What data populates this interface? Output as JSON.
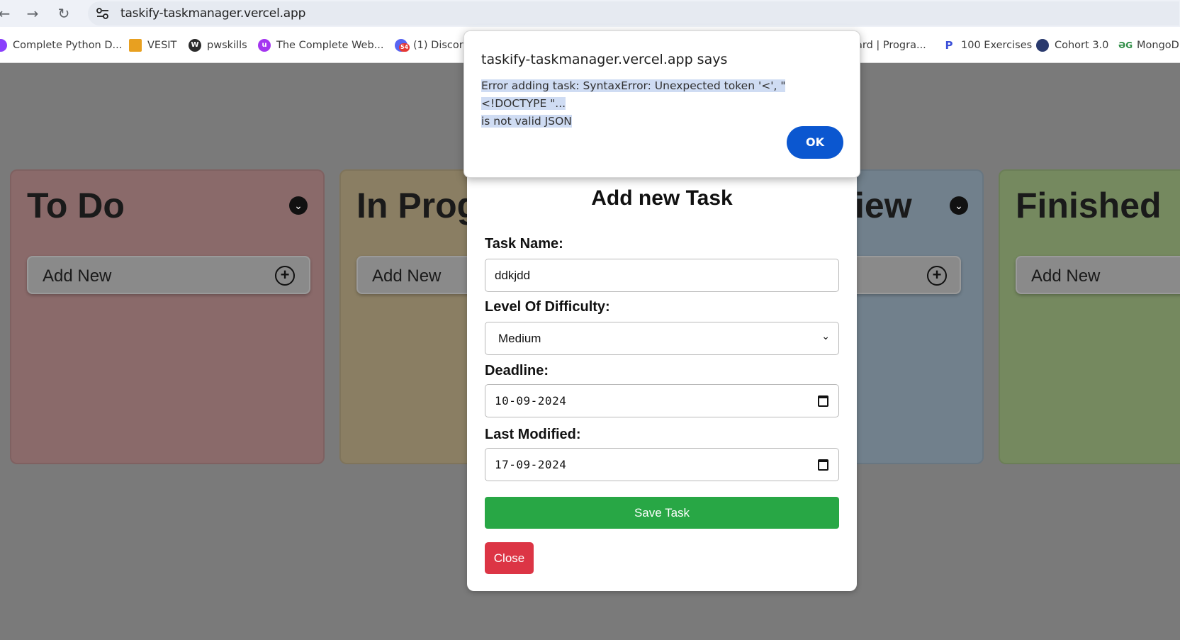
{
  "browser": {
    "url": "taskify-taskmanager.vercel.app",
    "bookmarks": [
      {
        "label": "Complete Python D...",
        "icon": "purple-logo-icon"
      },
      {
        "label": "VESIT",
        "icon": "vesit-logo-icon"
      },
      {
        "label": "pwskills",
        "icon": "wordpress-icon"
      },
      {
        "label": "The Complete Web...",
        "icon": "udemy-icon"
      },
      {
        "label": "(1) Discord",
        "icon": "discord-icon",
        "badge": "54"
      },
      {
        "label": "ard | Progra...",
        "icon": ""
      },
      {
        "label": "100 Exercises",
        "icon": "p-logo-icon"
      },
      {
        "label": "Cohort 3.0",
        "icon": "avatar-icon"
      },
      {
        "label": "MongoD",
        "icon": "gfg-icon"
      }
    ]
  },
  "board": {
    "columns": [
      {
        "title": "To Do",
        "add_label": "Add New",
        "color": "#8a6a6a"
      },
      {
        "title": "In Prog",
        "add_label": "Add New",
        "color": "#8a7e63"
      },
      {
        "title": "iew",
        "add_label": "",
        "color": "#71808c"
      },
      {
        "title": "Finished",
        "add_label": "Add New",
        "color": "#75895f"
      }
    ]
  },
  "modal": {
    "title": "Add new Task",
    "task_name_label": "Task Name:",
    "task_name_value": "ddkjdd",
    "difficulty_label": "Level Of Difficulty:",
    "difficulty_value": "Medium",
    "deadline_label": "Deadline:",
    "deadline_value": "10-09-2024",
    "last_modified_label": "Last Modified:",
    "last_modified_value": "17-09-2024",
    "save_label": "Save Task",
    "close_label": "Close"
  },
  "alert": {
    "title": "taskify-taskmanager.vercel.app says",
    "message_line1": "Error adding task: SyntaxError: Unexpected token '<', \"<!DOCTYPE \"...",
    "message_line2": "is not valid JSON",
    "ok_label": "OK"
  },
  "colors": {
    "save": "#28a745",
    "close": "#dc3545",
    "ok": "#0b57d0",
    "overlay": "#7a7a7a"
  }
}
